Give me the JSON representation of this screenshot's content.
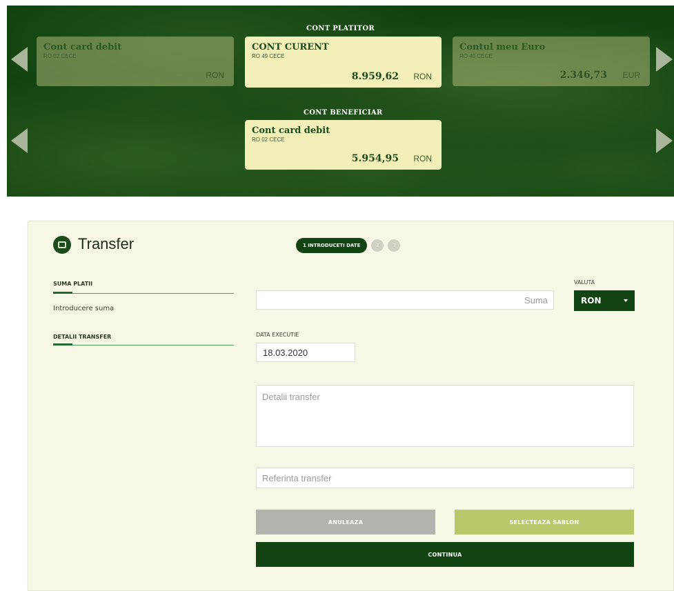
{
  "payer": {
    "section_title": "CONT PLATITOR",
    "accounts": [
      {
        "name": "Cont card debit",
        "iban": "RO 02 CECE",
        "amount": "",
        "currency": "RON"
      },
      {
        "name": "CONT CURENT",
        "iban": "RO 49 CECE",
        "amount": "8.959,62",
        "currency": "RON"
      },
      {
        "name": "Contul meu Euro",
        "iban": "RO 40 CECE",
        "amount": "2.346,73",
        "currency": "EUR"
      }
    ]
  },
  "beneficiary": {
    "section_title": "CONT BENEFICIAR",
    "account": {
      "name": "Cont card debit",
      "iban": "RO 02 CECE",
      "amount": "5.954,95",
      "currency": "RON"
    }
  },
  "form": {
    "title": "Transfer",
    "steps": {
      "active": "1 INTRODUCETI DATE",
      "step2": "2",
      "step3": "3"
    },
    "sidebar": {
      "section1": "SUMA PLATII",
      "section1_text": "Introducere suma",
      "section2": "DETALII TRANSFER"
    },
    "amount_placeholder": "Suma",
    "currency_label": "VALUTA",
    "currency_value": "RON",
    "date_label": "DATA EXECUTIE",
    "date_value": "18.03.2020",
    "details_placeholder": "Detalii transfer",
    "reference_placeholder": "Referinta transfer",
    "cancel_label": "ANULEAZA",
    "template_label": "SELECTEAZA SABLON",
    "continue_label": "CONTINUA"
  },
  "colors": {
    "dark_green": "#124312",
    "light_card": "#f2f0b8",
    "panel_bg": "#f7f7e6",
    "template_btn": "#b7c96a",
    "cancel_btn": "#b3b3ad"
  }
}
